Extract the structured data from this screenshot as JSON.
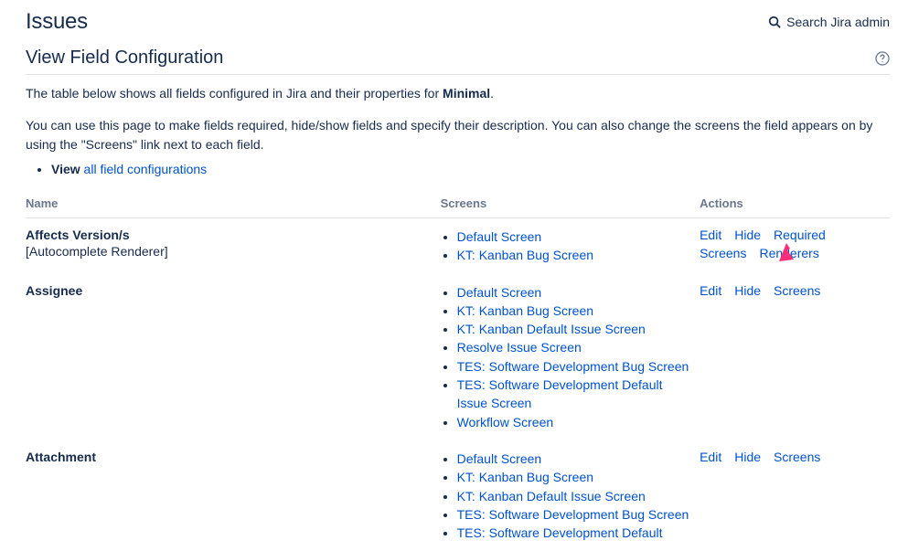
{
  "header": {
    "page_title": "Issues",
    "search_label": "Search Jira admin"
  },
  "subheader": {
    "title": "View Field Configuration"
  },
  "intro": {
    "line1_prefix": "The table below shows all fields configured in Jira and their properties for ",
    "line1_bold": "Minimal",
    "line1_suffix": ".",
    "line2": "You can use this page to make fields required, hide/show fields and specify their description. You can also change the screens the field appears on by using the \"Screens\" link next to each field.",
    "view_prefix": "View ",
    "view_link": "all field configurations"
  },
  "table": {
    "headers": {
      "name": "Name",
      "screens": "Screens",
      "actions": "Actions"
    },
    "rows": [
      {
        "name": "Affects Version/s",
        "sub": "[Autocomplete Renderer]",
        "screens": [
          "Default Screen",
          "KT: Kanban Bug Screen"
        ],
        "actions": [
          "Edit",
          "Hide",
          "Required",
          "Screens",
          "Renderers"
        ]
      },
      {
        "name": "Assignee",
        "sub": "",
        "screens": [
          "Default Screen",
          "KT: Kanban Bug Screen",
          "KT: Kanban Default Issue Screen",
          "Resolve Issue Screen",
          "TES: Software Development Bug Screen",
          "TES: Software Development Default Issue Screen",
          "Workflow Screen"
        ],
        "actions": [
          "Edit",
          "Hide",
          "Screens"
        ]
      },
      {
        "name": "Attachment",
        "sub": "",
        "screens": [
          "Default Screen",
          "KT: Kanban Bug Screen",
          "KT: Kanban Default Issue Screen",
          "TES: Software Development Bug Screen",
          "TES: Software Development Default"
        ],
        "actions": [
          "Edit",
          "Hide",
          "Screens"
        ]
      }
    ]
  }
}
